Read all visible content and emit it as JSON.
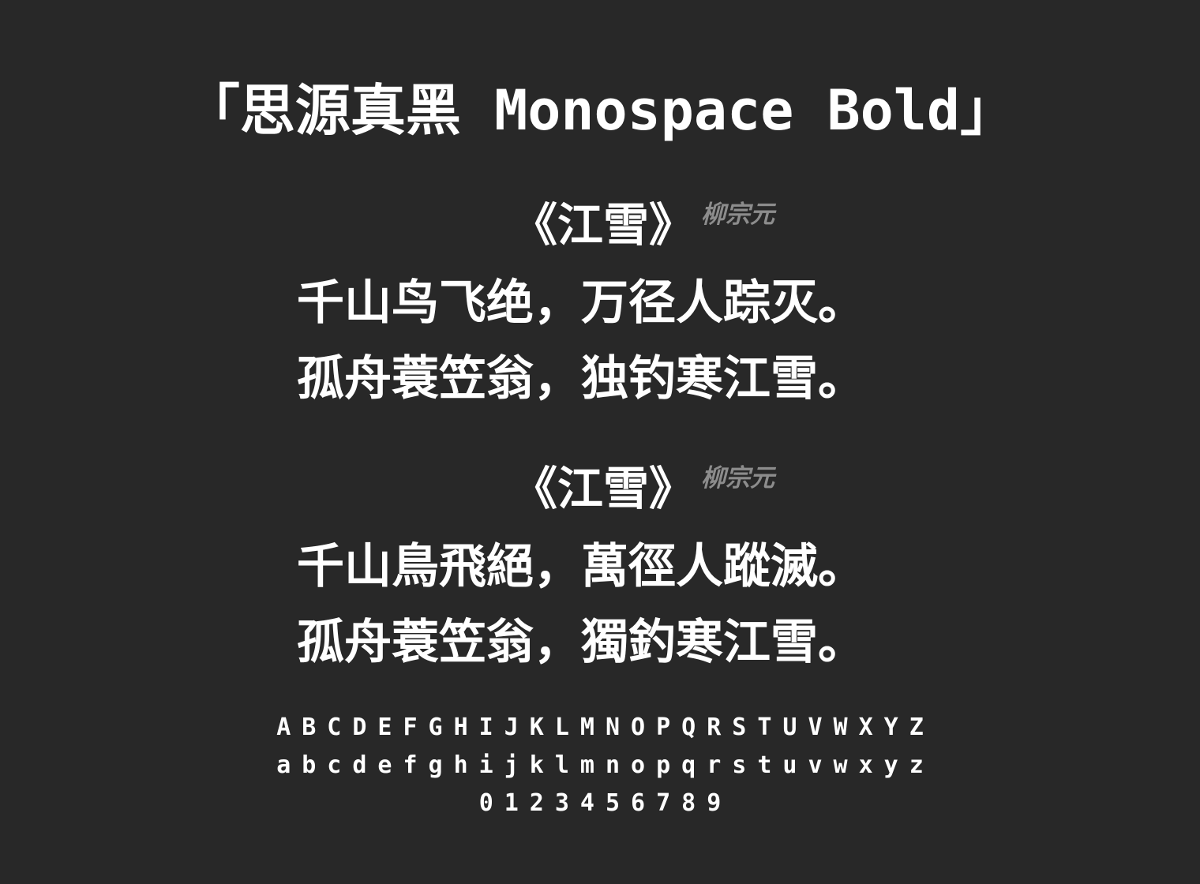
{
  "title": "「思源真黑 Monospace Bold」",
  "poems": [
    {
      "title": "《江雪》",
      "author": "柳宗元",
      "lines": [
        "千山鸟飞绝，万径人踪灭。",
        "孤舟蓑笠翁，独钓寒江雪。"
      ]
    },
    {
      "title": "《江雪》",
      "author": "柳宗元",
      "lines": [
        "千山鳥飛絕，萬徑人蹤滅。",
        "孤舟蓑笠翁，獨釣寒江雪。"
      ]
    }
  ],
  "alphabet": {
    "upper": "ABCDEFGHIJKLMNOPQRSTUVWXYZ",
    "lower": "abcdefghijklmnopqrstuvwxyz",
    "digits": "0123456789"
  }
}
